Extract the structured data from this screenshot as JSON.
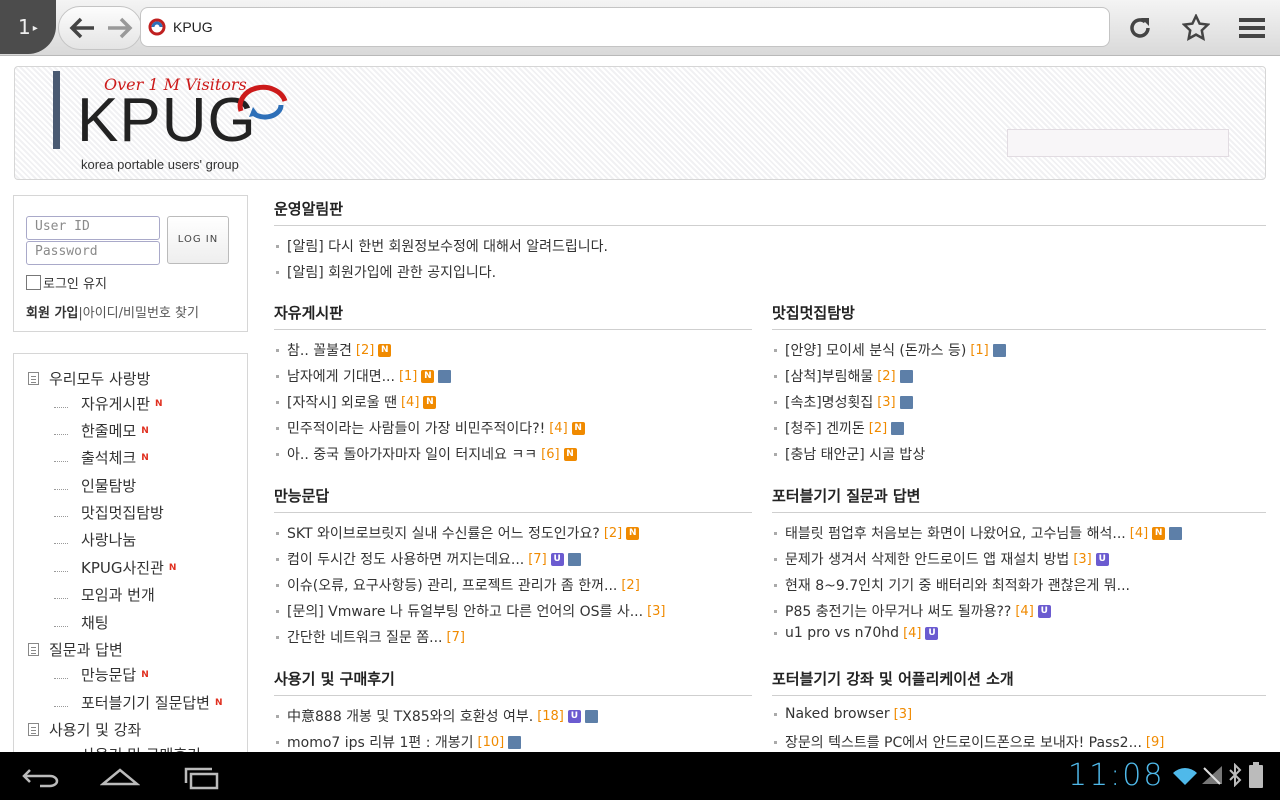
{
  "browser": {
    "tab_count": "1",
    "url_text": "KPUG"
  },
  "header": {
    "logo_over": "Over 1 M Visitors",
    "logo_name": "KPUG",
    "logo_sub": "korea portable users' group"
  },
  "login": {
    "userid_placeholder": "User ID",
    "password_placeholder": "Password",
    "login_label": "LOG IN",
    "keep_label": "로그인 유지",
    "join_label": "회원 가입",
    "find_label": "아이디/비밀번호 찾기"
  },
  "menu": {
    "items": [
      {
        "label": "우리모두 사랑방",
        "level": "top",
        "new": false
      },
      {
        "label": "자유게시판",
        "level": "sub",
        "new": true
      },
      {
        "label": "한줄메모",
        "level": "sub",
        "new": true
      },
      {
        "label": "출석체크",
        "level": "sub",
        "new": true
      },
      {
        "label": "인물탐방",
        "level": "sub",
        "new": false
      },
      {
        "label": "맛집멋집탐방",
        "level": "sub",
        "new": false
      },
      {
        "label": "사랑나눔",
        "level": "sub",
        "new": false
      },
      {
        "label": "KPUG사진관",
        "level": "sub",
        "new": true
      },
      {
        "label": "모임과 번개",
        "level": "sub",
        "new": false
      },
      {
        "label": "채팅",
        "level": "sub",
        "new": false
      },
      {
        "label": "질문과 답변",
        "level": "top",
        "new": false
      },
      {
        "label": "만능문답",
        "level": "sub",
        "new": true
      },
      {
        "label": "포터블기기 질문답변",
        "level": "sub",
        "new": true
      },
      {
        "label": "사용기 및 강좌",
        "level": "top",
        "new": false
      },
      {
        "label": "사용기 및 구매후기",
        "level": "sub",
        "new": false
      }
    ],
    "new_mark": "N"
  },
  "sections": {
    "notice": {
      "title": "운영알림판",
      "posts": [
        {
          "title": "[알림] 다시 한번 회원정보수정에 대해서 알려드립니다.",
          "count": "",
          "icons": []
        },
        {
          "title": "[알림] 회원가입에 관한 공지입니다.",
          "count": "",
          "icons": []
        }
      ]
    },
    "free": {
      "title": "자유게시판",
      "posts": [
        {
          "title": "참.. 꼴불견",
          "count": "[2]",
          "icons": [
            "N"
          ]
        },
        {
          "title": "남자에게 기대면...",
          "count": "[1]",
          "icons": [
            "N",
            "D"
          ]
        },
        {
          "title": "[자작시] 외로울 땐",
          "count": "[4]",
          "icons": [
            "N"
          ]
        },
        {
          "title": "민주적이라는 사람들이 가장 비민주적이다?!",
          "count": "[4]",
          "icons": [
            "N"
          ]
        },
        {
          "title": "아.. 중국 돌아가자마자 일이 터지네요 ㅋㅋ",
          "count": "[6]",
          "icons": [
            "N"
          ]
        }
      ]
    },
    "food": {
      "title": "맛집멋집탐방",
      "posts": [
        {
          "title": "[안양] 모이세 분식 (돈까스 등)",
          "count": "[1]",
          "icons": [
            "D"
          ]
        },
        {
          "title": "[삼척]부림해물",
          "count": "[2]",
          "icons": [
            "D"
          ]
        },
        {
          "title": "[속초]명성횟집",
          "count": "[3]",
          "icons": [
            "D"
          ]
        },
        {
          "title": "[청주] 겐끼돈",
          "count": "[2]",
          "icons": [
            "D"
          ]
        },
        {
          "title": "[충남 태안군] 시골 밥상",
          "count": "",
          "icons": []
        }
      ]
    },
    "qa": {
      "title": "만능문답",
      "posts": [
        {
          "title": "SKT 와이브로브릿지 실내 수신률은 어느 정도인가요?",
          "count": "[2]",
          "icons": [
            "N"
          ]
        },
        {
          "title": "컴이 두시간 정도 사용하면 꺼지는데요...",
          "count": "[7]",
          "icons": [
            "U",
            "D"
          ]
        },
        {
          "title": "이슈(오류, 요구사항등) 관리, 프로젝트 관리가 좀 한꺼...",
          "count": "[2]",
          "icons": []
        },
        {
          "title": "[문의] Vmware 나 듀얼부팅 안하고 다른 언어의 OS를 사...",
          "count": "[3]",
          "icons": []
        },
        {
          "title": "간단한 네트워크 질문 쫌...",
          "count": "[7]",
          "icons": []
        }
      ]
    },
    "portable_qa": {
      "title": "포터블기기 질문과 답변",
      "posts": [
        {
          "title": "태블릿 펌업후 처음보는 화면이 나왔어요, 고수님들 해석...",
          "count": "[4]",
          "icons": [
            "N",
            "D"
          ]
        },
        {
          "title": "문제가 생겨서 삭제한 안드로이드 앱 재설치 방법",
          "count": "[3]",
          "icons": [
            "U"
          ]
        },
        {
          "title": "현재 8~9.7인치 기기 중 배터리와 최적화가 괜찮은게 뭐...",
          "count": "",
          "icons": []
        },
        {
          "title": "P85 충전기는 아무거나 써도 될까용??",
          "count": "[4]",
          "icons": [
            "U"
          ]
        },
        {
          "title": "u1 pro vs n70hd",
          "count": "[4]",
          "icons": [
            "U"
          ]
        }
      ]
    },
    "review": {
      "title": "사용기 및 구매후기",
      "posts": [
        {
          "title": "中意888 개봉 및 TX85와의 호환성 여부.",
          "count": "[18]",
          "icons": [
            "U",
            "D"
          ]
        },
        {
          "title": "momo7 ips 리뷰 1편 : 개봉기",
          "count": "[10]",
          "icons": [
            "D"
          ]
        }
      ]
    },
    "app": {
      "title": "포터블기기 강좌 및 어플리케이션 소개",
      "posts": [
        {
          "title": "Naked browser",
          "count": "[3]",
          "icons": []
        },
        {
          "title": "장문의 텍스트를 PC에서 안드로이드폰으로 보내자! Pass2...",
          "count": "[9]",
          "icons": []
        }
      ]
    }
  },
  "system": {
    "clock": "11:08"
  },
  "colors": {
    "count": "#f08a00",
    "new_badge": "#f08a00",
    "u_badge": "#6b5bd0",
    "clock": "#4fb9ea"
  }
}
